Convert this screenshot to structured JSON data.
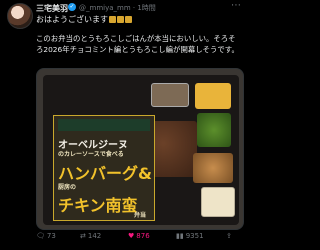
{
  "tweet": {
    "display_name": "三宅美羽",
    "handle": "@_mmiya_mm",
    "time": "· 1時間",
    "greeting": "おはようございます",
    "text": "このお弁当のとうもろこしごはんが本当においしい。そろそろ2026年チョコミント編とうもろこし編が開幕しそうです。",
    "more_icon": "more-icon",
    "verified_icon": "verified-badge-icon"
  },
  "label": {
    "line1": "オーベルジーヌ",
    "line2": "のカレーソースで食べる",
    "line3": "ハンバーグ&",
    "line4": "厨房の",
    "line5": "チキン南蛮",
    "line6": "弁当"
  },
  "stats": {
    "replies": "73",
    "reposts": "142",
    "likes": "876",
    "views": "9351"
  },
  "colors": {
    "accent": "#1d9bf0",
    "like": "#f91880",
    "muted": "#71767b"
  }
}
